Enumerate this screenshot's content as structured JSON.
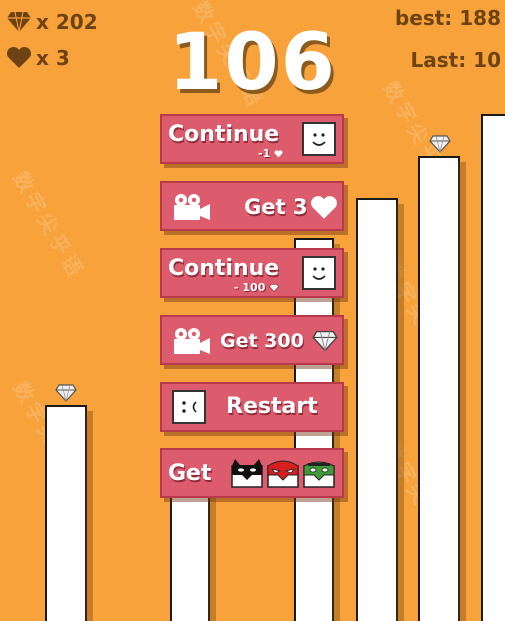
{
  "hud": {
    "gems": "x 202",
    "lives": "x 3",
    "best": "best: 188",
    "last": "Last: 10"
  },
  "score": "106",
  "buttons": {
    "continue_heart": {
      "label": "Continue",
      "cost": "-1"
    },
    "get_lives": {
      "label": "Get 3"
    },
    "continue_gems": {
      "label": "Continue",
      "cost": "- 100"
    },
    "get_gems": {
      "label": "Get 300"
    },
    "restart": {
      "label": "Restart"
    },
    "get_masks": {
      "label": "Get"
    }
  },
  "watermark": "数字尖乎语",
  "colors": {
    "background": "#f7a23a",
    "button": "#dc5b6c",
    "hud_text": "#6e4313"
  },
  "icons": [
    "diamond-icon",
    "heart-icon",
    "smiley-face-icon",
    "video-camera-icon",
    "sad-face-icon",
    "batman-mask-icon",
    "spiderman-mask-icon",
    "hulk-mask-icon"
  ]
}
